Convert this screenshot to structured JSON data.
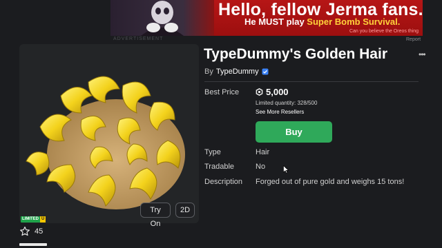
{
  "ad": {
    "headline": "Hello, fellow Jerma fans.",
    "subline_start": "He MUST play ",
    "subline_highlight": "Super Bomb Survival.",
    "fine_print": "Can you believe the Oreos thing",
    "label": "ADVERTISEMENT",
    "report": "Report"
  },
  "item": {
    "title": "TypeDummy's Golden Hair",
    "by_prefix": "By",
    "creator": "TypeDummy",
    "badge_limited": "LIMITED",
    "badge_unique": "U",
    "favorites": "45"
  },
  "thumbnail": {
    "try_on_label": "Try On",
    "view_2d_label": "2D"
  },
  "details": {
    "best_price_label": "Best Price",
    "price": "5,000",
    "limited_quantity": "Limited quantity: 328/500",
    "see_resellers": "See More Resellers",
    "buy_label": "Buy",
    "type_label": "Type",
    "type_value": "Hair",
    "tradable_label": "Tradable",
    "tradable_value": "No",
    "description_label": "Description",
    "description_value": "Forged out of pure gold and weighs 15 tons!"
  },
  "icons": {
    "more": "more-options-icon",
    "verified": "verified-badge-icon",
    "robux": "robux-icon",
    "favorite": "star-icon"
  },
  "colors": {
    "background": "#1b1c1f",
    "buy_green": "#2fa95a",
    "verified_blue": "#3b82f6",
    "hair_gold": "#f3d21c",
    "ad_red": "#b61616"
  }
}
